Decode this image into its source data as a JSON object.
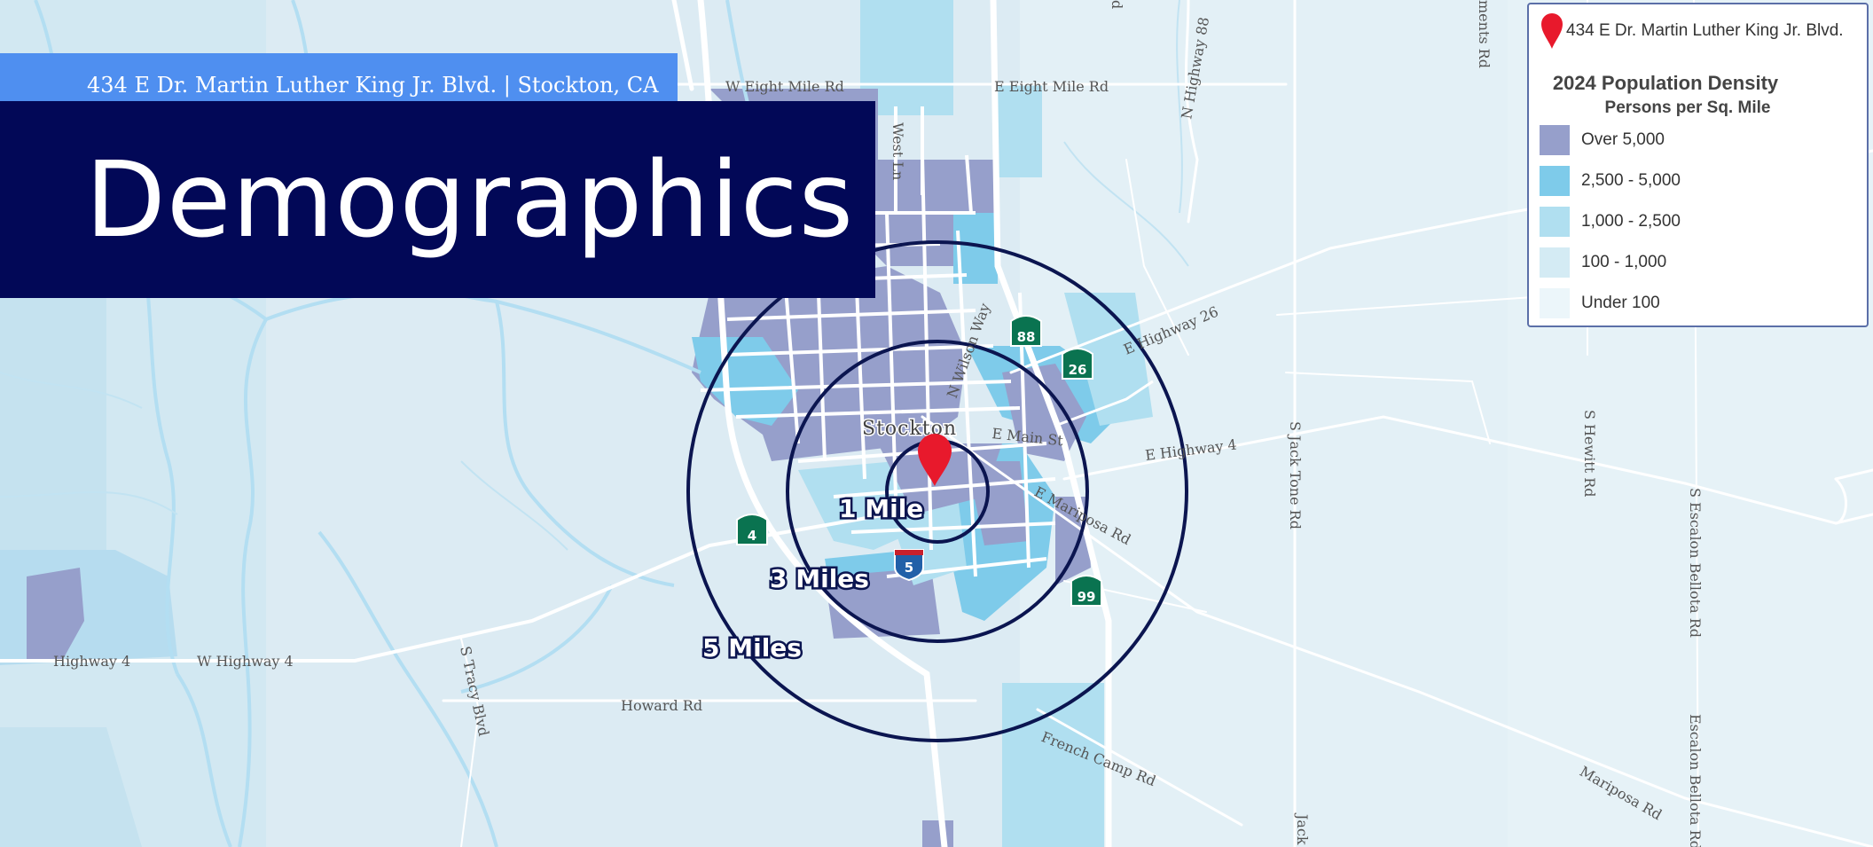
{
  "header": {
    "address_line": "434 E Dr. Martin Luther King Jr. Blvd. | Stockton, CA",
    "title": "Demographics"
  },
  "legend": {
    "marker_label": "434 E Dr. Martin Luther King Jr. Blvd.",
    "title": "2024 Population Density",
    "subtitle": "Persons per Sq. Mile",
    "items": [
      {
        "label": "Over 5,000",
        "color": "#969fcb"
      },
      {
        "label": "2,500 - 5,000",
        "color": "#7ecbea"
      },
      {
        "label": "1,000 - 2,500",
        "color": "#b0dff0"
      },
      {
        "label": "100 - 1,000",
        "color": "#d4ebf4"
      },
      {
        "label": "Under 100",
        "color": "#ecf6fa"
      }
    ]
  },
  "map": {
    "city": "Stockton",
    "rings": [
      {
        "label": "1 Mile"
      },
      {
        "label": "3 Miles"
      },
      {
        "label": "5 Miles"
      }
    ],
    "ring_color": "#0b1550",
    "marker_color": "#e8192c",
    "road_labels": {
      "w_eight_mile": "W Eight Mile Rd",
      "e_eight_mile": "E Eight Mile Rd",
      "west_ln": "West Ln",
      "n_hwy_88": "N Highway 88",
      "clements": "ments Rd",
      "n_wilson": "N Wilson Way",
      "e_hwy_26": "E Highway 26",
      "e_main": "E Main St",
      "e_hwy_4": "E Highway 4",
      "e_mariposa": "E Mariposa Rd",
      "s_jack_tone": "S Jack Tone Rd",
      "jack_bottom": "Jack",
      "s_hewitt": "S Hewitt Rd",
      "s_escalon_1": "S Escalon Bellota Rd",
      "s_escalon_2": "Escalon Bellota Rd",
      "highway_4": "Highway 4",
      "w_highway_4": "W Highway 4",
      "s_tracy": "S Tracy Blvd",
      "howard": "Howard Rd",
      "french_camp": "French Camp Rd",
      "mariposa": "Mariposa Rd",
      "top_partial": "d"
    },
    "shields": [
      {
        "num": "88",
        "type": "state"
      },
      {
        "num": "26",
        "type": "state"
      },
      {
        "num": "4",
        "type": "state"
      },
      {
        "num": "5",
        "type": "interstate"
      },
      {
        "num": "99",
        "type": "state"
      }
    ]
  }
}
